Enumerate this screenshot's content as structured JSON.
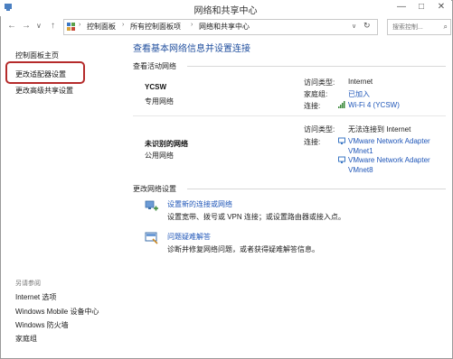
{
  "window": {
    "title": "网络和共享中心",
    "controls": {
      "minimize": "—",
      "maximize": "□",
      "close": "✕"
    }
  },
  "address": {
    "crumbs": [
      "控制面板",
      "所有控制面板项",
      "网络和共享中心"
    ],
    "search_placeholder": "搜索控制...",
    "nav_back": "←",
    "nav_forward": "→",
    "nav_dropdown": "∨",
    "nav_up": "↑"
  },
  "sidebar": {
    "home": "控制面板主页",
    "items": [
      {
        "label": "更改适配器设置",
        "highlighted": true
      },
      {
        "label": "更改高级共享设置"
      }
    ],
    "see_also_title": "另请参阅",
    "see_also": [
      "Internet 选项",
      "Windows Mobile 设备中心",
      "Windows 防火墙",
      "家庭组"
    ]
  },
  "main": {
    "heading": "查看基本网络信息并设置连接",
    "active_networks_label": "查看活动网络",
    "networks": [
      {
        "name": "YCSW",
        "category": "专用网络",
        "access_type_label": "访问类型:",
        "access_type": "Internet",
        "homegroup_label": "家庭组:",
        "homegroup": "已加入",
        "connection_label": "连接:",
        "connection": "Wi-Fi 4 (YCSW)"
      },
      {
        "name": "未识别的网络",
        "category": "公用网络",
        "access_type_label": "访问类型:",
        "access_type": "无法连接到 Internet",
        "connection_label": "连接:",
        "connections": [
          {
            "line1": "VMware Network Adapter",
            "line2": "VMnet1"
          },
          {
            "line1": "VMware Network Adapter",
            "line2": "VMnet8"
          }
        ]
      }
    ],
    "change_settings_label": "更改网络设置",
    "tasks": [
      {
        "title": "设置新的连接或网络",
        "desc": "设置宽带、拨号或 VPN 连接；或设置路由器或接入点。"
      },
      {
        "title": "问题疑难解答",
        "desc": "诊断并修复网络问题，或者获得疑难解答信息。"
      }
    ]
  },
  "colors": {
    "link": "#1f56b8",
    "heading": "#1f4e9e",
    "highlight_border": "#b52b2b"
  }
}
